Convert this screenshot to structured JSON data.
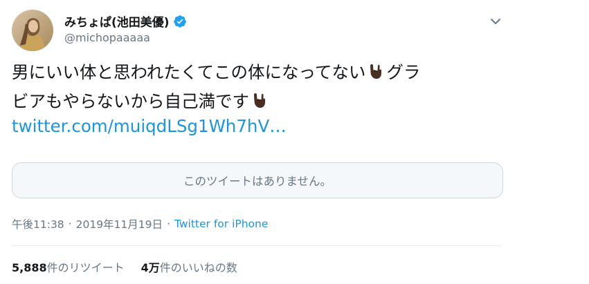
{
  "tweet": {
    "display_name": "みちょぱ(池田美優)",
    "handle": "@michopaaaaa",
    "text_line1": "男にいい体と思われたくてこの体になってない",
    "text_line1_tail": "グラ",
    "text_line2": "ビアもやらないから自己満です",
    "link_text": "twitter.com/muiqdLSg1Wh7hV…",
    "quote_unavailable": "このツイートはありません。",
    "time": "午後11:38",
    "date": "2019年11月19日",
    "separator": "·",
    "source": "Twitter for iPhone",
    "retweet_count": "5,888",
    "retweet_label": "件のリツイート",
    "like_count": "4万",
    "like_label": "件のいいねの数"
  },
  "icons": {
    "verified": "verified-badge-icon",
    "caret": "chevron-down-icon",
    "emoji": "sign-of-the-horns-dark-skin-tone-emoji"
  },
  "colors": {
    "link": "#1b95e0",
    "muted": "#657786",
    "text": "#14171a",
    "border": "#ccd6dd",
    "verified": "#1da1f2"
  }
}
